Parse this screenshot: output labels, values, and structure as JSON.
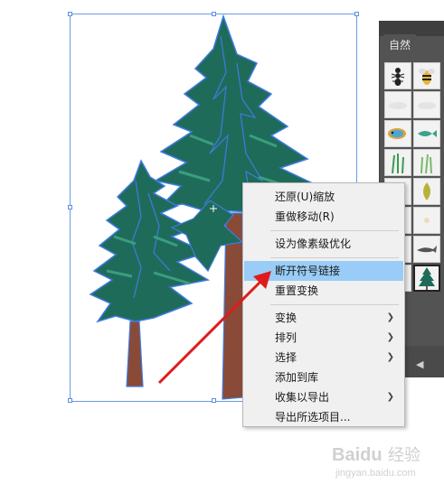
{
  "panel": {
    "tab_label": "自然",
    "symbols": [
      "ant-icon",
      "bee-icon",
      "cloud-icon",
      "cloud-icon",
      "fish-icon",
      "fish-icon",
      "grass-icon",
      "grass-icon",
      "ladybug-icon",
      "leaf-icon",
      "sheep-icon",
      "sheep-icon",
      "bird-icon",
      "shark-icon",
      "tree-icon",
      "tree-icon"
    ]
  },
  "context_menu": {
    "items": [
      {
        "label": "还原(U)缩放",
        "submenu": false
      },
      {
        "label": "重做移动(R)",
        "submenu": false
      },
      {
        "label": "设为像素级优化",
        "submenu": false
      },
      {
        "label": "断开符号链接",
        "submenu": false,
        "highlighted": true
      },
      {
        "label": "重置变换",
        "submenu": false
      },
      {
        "label": "变换",
        "submenu": true
      },
      {
        "label": "排列",
        "submenu": true
      },
      {
        "label": "选择",
        "submenu": true
      },
      {
        "label": "添加到库",
        "submenu": false
      },
      {
        "label": "收集以导出",
        "submenu": true
      },
      {
        "label": "导出所选项目...",
        "submenu": false
      }
    ]
  },
  "watermark": {
    "text": "Baidu 经验",
    "url_text": "jingyan.baidu.com"
  },
  "colors": {
    "tree_green": "#1f6b5a",
    "tree_light": "#3a9e7e",
    "trunk": "#8a4a38",
    "selection": "#4a7ee0",
    "arrow": "#e01b1b",
    "highlight": "#99ccf7"
  }
}
